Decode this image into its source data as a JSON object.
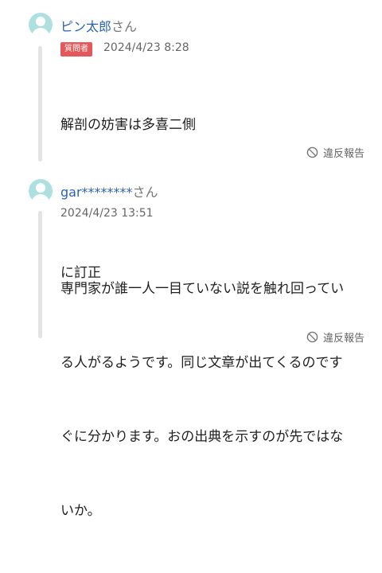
{
  "comments": [
    {
      "username": "ピン太郎",
      "suffix": "さん",
      "badge": "質問者",
      "timestamp": "2024/4/23 8:28",
      "lines": [
        "解剖の妨害は多喜二側",
        "",
        "に訂正"
      ],
      "report_label": "違反報告"
    },
    {
      "username": "gar********",
      "suffix": "さん",
      "timestamp": "2024/4/23 13:51",
      "lines": [
        "専門家が誰一人一目ていない説を触れ回ってい",
        "る人がるようです。同じ文章が出てくるのです",
        "ぐに分かります。おの出典を示すのが先ではな",
        "いか。"
      ],
      "report_label": "違反報告"
    }
  ]
}
